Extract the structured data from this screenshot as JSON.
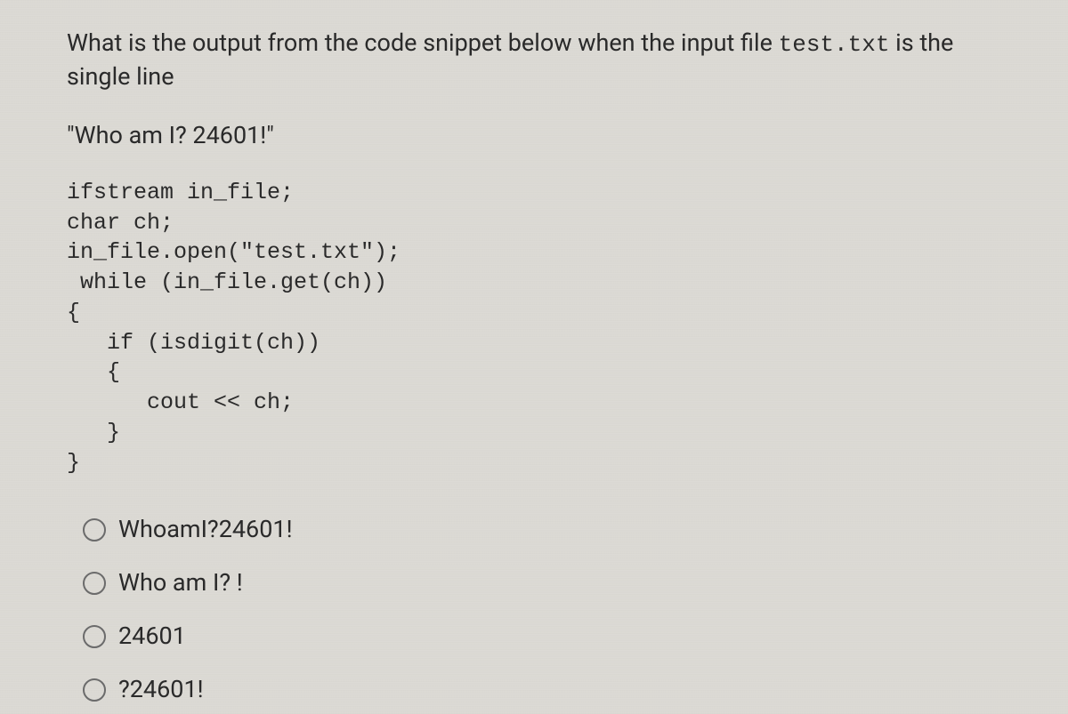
{
  "question": {
    "stem_part1": "What is the output from the code snippet below when the input file ",
    "stem_code": "test.txt",
    "stem_part2": " is the single line",
    "input_line": "\"Who am I? 24601!\"",
    "code": "ifstream in_file;\nchar ch;\nin_file.open(\"test.txt\");\n while (in_file.get(ch))\n{\n   if (isdigit(ch))\n   {\n      cout << ch;\n   }\n}"
  },
  "options": [
    {
      "label": "WhoamI?24601!"
    },
    {
      "label": "Who am I? !"
    },
    {
      "label": "24601"
    },
    {
      "label": "?24601!"
    }
  ]
}
